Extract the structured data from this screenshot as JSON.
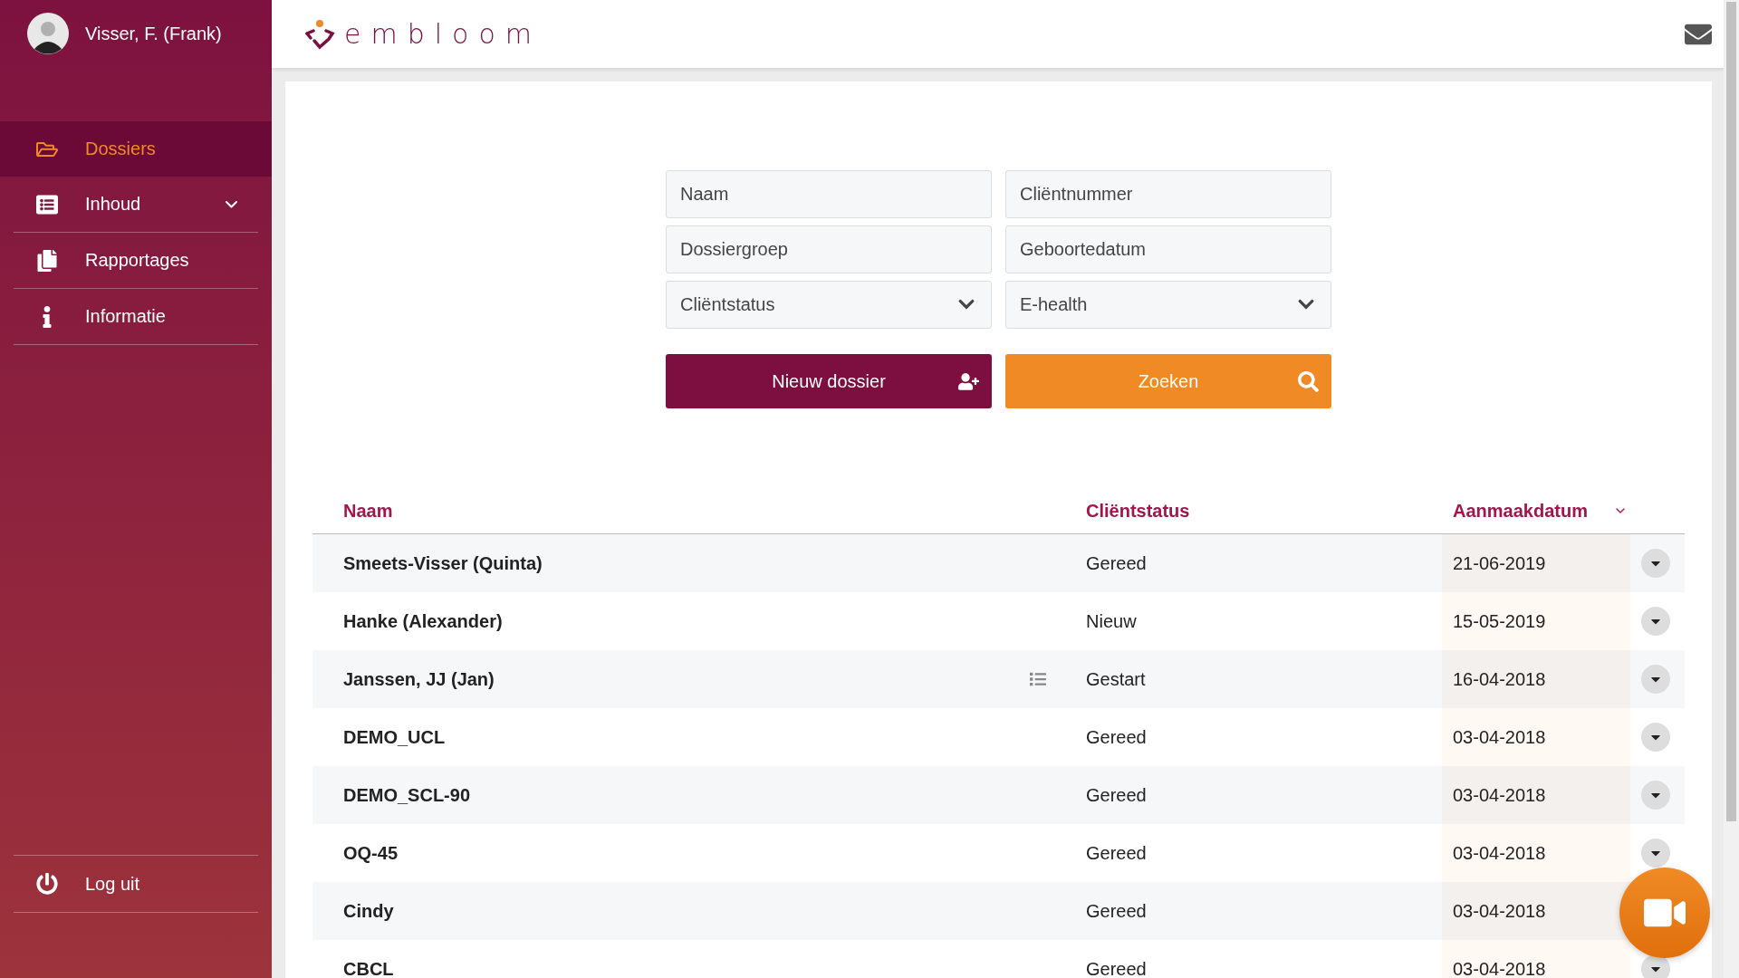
{
  "user": {
    "name": "Visser, F. (Frank)"
  },
  "sidebar": {
    "items": [
      {
        "label": "Dossiers",
        "kind": "link",
        "selected": true
      },
      {
        "label": "Inhoud",
        "kind": "group",
        "selected": false
      },
      {
        "label": "Rapportages",
        "kind": "link",
        "selected": false
      },
      {
        "label": "Informatie",
        "kind": "link",
        "selected": false
      }
    ],
    "logout": "Log uit"
  },
  "header": {
    "logo": "embloom"
  },
  "search": {
    "fields": [
      {
        "placeholder": "Naam",
        "kind": "text"
      },
      {
        "placeholder": "Cliëntnummer",
        "kind": "text"
      },
      {
        "placeholder": "Dossiergroep",
        "kind": "text"
      },
      {
        "placeholder": "Geboortedatum",
        "kind": "text"
      },
      {
        "placeholder": "Cliëntstatus",
        "kind": "select"
      },
      {
        "placeholder": "E-health",
        "kind": "select"
      }
    ],
    "buttons": [
      {
        "label": "Nieuw dossier",
        "kind": "new"
      },
      {
        "label": "Zoeken",
        "kind": "search"
      }
    ]
  },
  "table": {
    "columns": [
      {
        "label": "Naam",
        "sorted": false
      },
      {
        "label": "Cliëntstatus",
        "sorted": false
      },
      {
        "label": "Aanmaakdatum",
        "sorted": true
      }
    ],
    "rows": [
      {
        "name": "Smeets-Visser (Quinta)",
        "status": "Gereed",
        "date": "21-06-2019",
        "has_notes": false
      },
      {
        "name": "Hanke (Alexander)",
        "status": "Nieuw",
        "date": "15-05-2019",
        "has_notes": false
      },
      {
        "name": "Janssen, JJ (Jan)",
        "status": "Gestart",
        "date": "16-04-2018",
        "has_notes": true
      },
      {
        "name": "DEMO_UCL",
        "status": "Gereed",
        "date": "03-04-2018",
        "has_notes": false
      },
      {
        "name": "DEMO_SCL-90",
        "status": "Gereed",
        "date": "03-04-2018",
        "has_notes": false
      },
      {
        "name": "OQ-45",
        "status": "Gereed",
        "date": "03-04-2018",
        "has_notes": false
      },
      {
        "name": "Cindy",
        "status": "Gereed",
        "date": "03-04-2018",
        "has_notes": false
      },
      {
        "name": "CBCL",
        "status": "Gereed",
        "date": "03-04-2018",
        "has_notes": false
      }
    ]
  }
}
